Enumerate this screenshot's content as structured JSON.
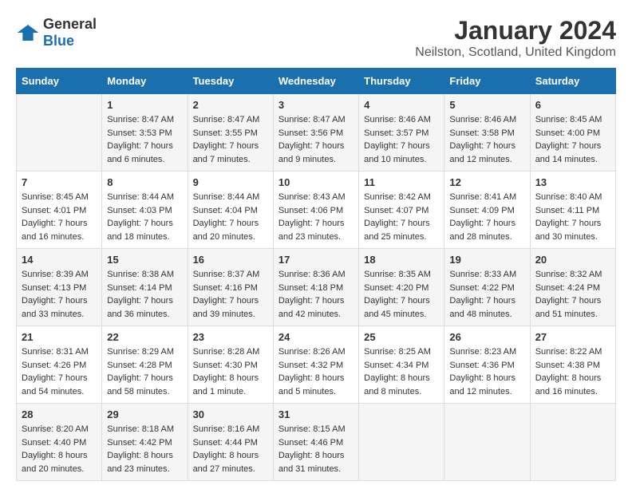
{
  "logo": {
    "general": "General",
    "blue": "Blue"
  },
  "title": "January 2024",
  "subtitle": "Neilston, Scotland, United Kingdom",
  "days_header": [
    "Sunday",
    "Monday",
    "Tuesday",
    "Wednesday",
    "Thursday",
    "Friday",
    "Saturday"
  ],
  "weeks": [
    [
      {
        "day": "",
        "sunrise": "",
        "sunset": "",
        "daylight": ""
      },
      {
        "day": "1",
        "sunrise": "Sunrise: 8:47 AM",
        "sunset": "Sunset: 3:53 PM",
        "daylight": "Daylight: 7 hours and 6 minutes."
      },
      {
        "day": "2",
        "sunrise": "Sunrise: 8:47 AM",
        "sunset": "Sunset: 3:55 PM",
        "daylight": "Daylight: 7 hours and 7 minutes."
      },
      {
        "day": "3",
        "sunrise": "Sunrise: 8:47 AM",
        "sunset": "Sunset: 3:56 PM",
        "daylight": "Daylight: 7 hours and 9 minutes."
      },
      {
        "day": "4",
        "sunrise": "Sunrise: 8:46 AM",
        "sunset": "Sunset: 3:57 PM",
        "daylight": "Daylight: 7 hours and 10 minutes."
      },
      {
        "day": "5",
        "sunrise": "Sunrise: 8:46 AM",
        "sunset": "Sunset: 3:58 PM",
        "daylight": "Daylight: 7 hours and 12 minutes."
      },
      {
        "day": "6",
        "sunrise": "Sunrise: 8:45 AM",
        "sunset": "Sunset: 4:00 PM",
        "daylight": "Daylight: 7 hours and 14 minutes."
      }
    ],
    [
      {
        "day": "7",
        "sunrise": "Sunrise: 8:45 AM",
        "sunset": "Sunset: 4:01 PM",
        "daylight": "Daylight: 7 hours and 16 minutes."
      },
      {
        "day": "8",
        "sunrise": "Sunrise: 8:44 AM",
        "sunset": "Sunset: 4:03 PM",
        "daylight": "Daylight: 7 hours and 18 minutes."
      },
      {
        "day": "9",
        "sunrise": "Sunrise: 8:44 AM",
        "sunset": "Sunset: 4:04 PM",
        "daylight": "Daylight: 7 hours and 20 minutes."
      },
      {
        "day": "10",
        "sunrise": "Sunrise: 8:43 AM",
        "sunset": "Sunset: 4:06 PM",
        "daylight": "Daylight: 7 hours and 23 minutes."
      },
      {
        "day": "11",
        "sunrise": "Sunrise: 8:42 AM",
        "sunset": "Sunset: 4:07 PM",
        "daylight": "Daylight: 7 hours and 25 minutes."
      },
      {
        "day": "12",
        "sunrise": "Sunrise: 8:41 AM",
        "sunset": "Sunset: 4:09 PM",
        "daylight": "Daylight: 7 hours and 28 minutes."
      },
      {
        "day": "13",
        "sunrise": "Sunrise: 8:40 AM",
        "sunset": "Sunset: 4:11 PM",
        "daylight": "Daylight: 7 hours and 30 minutes."
      }
    ],
    [
      {
        "day": "14",
        "sunrise": "Sunrise: 8:39 AM",
        "sunset": "Sunset: 4:13 PM",
        "daylight": "Daylight: 7 hours and 33 minutes."
      },
      {
        "day": "15",
        "sunrise": "Sunrise: 8:38 AM",
        "sunset": "Sunset: 4:14 PM",
        "daylight": "Daylight: 7 hours and 36 minutes."
      },
      {
        "day": "16",
        "sunrise": "Sunrise: 8:37 AM",
        "sunset": "Sunset: 4:16 PM",
        "daylight": "Daylight: 7 hours and 39 minutes."
      },
      {
        "day": "17",
        "sunrise": "Sunrise: 8:36 AM",
        "sunset": "Sunset: 4:18 PM",
        "daylight": "Daylight: 7 hours and 42 minutes."
      },
      {
        "day": "18",
        "sunrise": "Sunrise: 8:35 AM",
        "sunset": "Sunset: 4:20 PM",
        "daylight": "Daylight: 7 hours and 45 minutes."
      },
      {
        "day": "19",
        "sunrise": "Sunrise: 8:33 AM",
        "sunset": "Sunset: 4:22 PM",
        "daylight": "Daylight: 7 hours and 48 minutes."
      },
      {
        "day": "20",
        "sunrise": "Sunrise: 8:32 AM",
        "sunset": "Sunset: 4:24 PM",
        "daylight": "Daylight: 7 hours and 51 minutes."
      }
    ],
    [
      {
        "day": "21",
        "sunrise": "Sunrise: 8:31 AM",
        "sunset": "Sunset: 4:26 PM",
        "daylight": "Daylight: 7 hours and 54 minutes."
      },
      {
        "day": "22",
        "sunrise": "Sunrise: 8:29 AM",
        "sunset": "Sunset: 4:28 PM",
        "daylight": "Daylight: 7 hours and 58 minutes."
      },
      {
        "day": "23",
        "sunrise": "Sunrise: 8:28 AM",
        "sunset": "Sunset: 4:30 PM",
        "daylight": "Daylight: 8 hours and 1 minute."
      },
      {
        "day": "24",
        "sunrise": "Sunrise: 8:26 AM",
        "sunset": "Sunset: 4:32 PM",
        "daylight": "Daylight: 8 hours and 5 minutes."
      },
      {
        "day": "25",
        "sunrise": "Sunrise: 8:25 AM",
        "sunset": "Sunset: 4:34 PM",
        "daylight": "Daylight: 8 hours and 8 minutes."
      },
      {
        "day": "26",
        "sunrise": "Sunrise: 8:23 AM",
        "sunset": "Sunset: 4:36 PM",
        "daylight": "Daylight: 8 hours and 12 minutes."
      },
      {
        "day": "27",
        "sunrise": "Sunrise: 8:22 AM",
        "sunset": "Sunset: 4:38 PM",
        "daylight": "Daylight: 8 hours and 16 minutes."
      }
    ],
    [
      {
        "day": "28",
        "sunrise": "Sunrise: 8:20 AM",
        "sunset": "Sunset: 4:40 PM",
        "daylight": "Daylight: 8 hours and 20 minutes."
      },
      {
        "day": "29",
        "sunrise": "Sunrise: 8:18 AM",
        "sunset": "Sunset: 4:42 PM",
        "daylight": "Daylight: 8 hours and 23 minutes."
      },
      {
        "day": "30",
        "sunrise": "Sunrise: 8:16 AM",
        "sunset": "Sunset: 4:44 PM",
        "daylight": "Daylight: 8 hours and 27 minutes."
      },
      {
        "day": "31",
        "sunrise": "Sunrise: 8:15 AM",
        "sunset": "Sunset: 4:46 PM",
        "daylight": "Daylight: 8 hours and 31 minutes."
      },
      {
        "day": "",
        "sunrise": "",
        "sunset": "",
        "daylight": ""
      },
      {
        "day": "",
        "sunrise": "",
        "sunset": "",
        "daylight": ""
      },
      {
        "day": "",
        "sunrise": "",
        "sunset": "",
        "daylight": ""
      }
    ]
  ]
}
